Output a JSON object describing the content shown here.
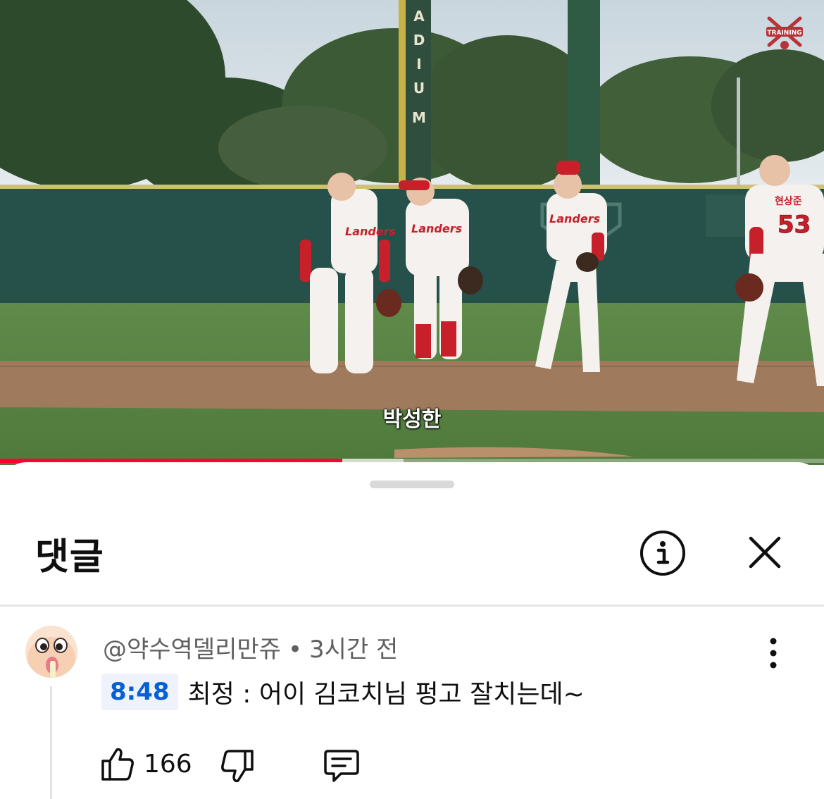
{
  "video": {
    "subtitle": "박성한",
    "stadium_sign_letters": [
      "A",
      "D",
      "I",
      "U",
      "M"
    ],
    "jersey_text": "Landers",
    "jersey_number": "53",
    "jersey_name": "현상준",
    "channel_logo_text": "TRAINING",
    "progress": 0.415,
    "buffered": 0.49,
    "progress_color": "#ff0033"
  },
  "comments_panel": {
    "title": "댓글",
    "info_icon": "info-icon",
    "close_icon": "close-icon"
  },
  "comment": {
    "author": "@약수역델리만쥬",
    "separator": "•",
    "time_ago": "3시간 전",
    "timestamp_link": "8:48",
    "text": "최정 : 어이 김코치님 펑고 잘치는데~",
    "like_count": "166",
    "icons": [
      "thumbs-up-icon",
      "thumbs-down-icon",
      "reply-icon",
      "more-vertical-icon"
    ]
  },
  "colors": {
    "link_blue": "#065fd4",
    "timestamp_bg": "#eef3fb",
    "text_primary": "#0f0f0f",
    "text_secondary": "#606060"
  }
}
